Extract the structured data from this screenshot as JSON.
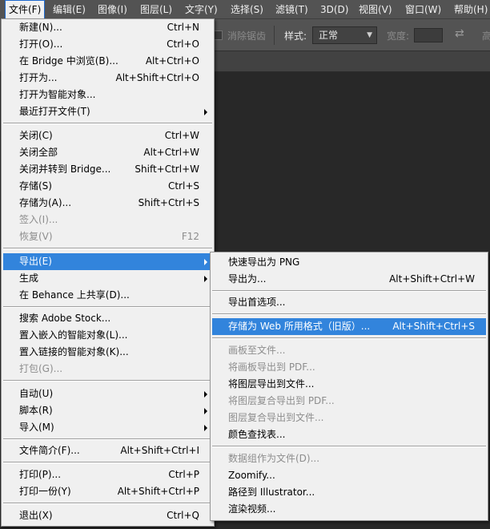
{
  "menubar": {
    "items": [
      {
        "label": "文件(F)"
      },
      {
        "label": "编辑(E)"
      },
      {
        "label": "图像(I)"
      },
      {
        "label": "图层(L)"
      },
      {
        "label": "文字(Y)"
      },
      {
        "label": "选择(S)"
      },
      {
        "label": "滤镜(T)"
      },
      {
        "label": "3D(D)"
      },
      {
        "label": "视图(V)"
      },
      {
        "label": "窗口(W)"
      },
      {
        "label": "帮助(H)"
      }
    ]
  },
  "options": {
    "antialias_label": "消除锯齿",
    "style_label": "样式:",
    "style_value": "正常",
    "width_label": "宽度:",
    "height_label_partial": "高"
  },
  "file_menu": {
    "items": [
      {
        "label": "新建(N)...",
        "shortcut": "Ctrl+N"
      },
      {
        "label": "打开(O)...",
        "shortcut": "Ctrl+O"
      },
      {
        "label": "在 Bridge 中浏览(B)...",
        "shortcut": "Alt+Ctrl+O"
      },
      {
        "label": "打开为...",
        "shortcut": "Alt+Shift+Ctrl+O"
      },
      {
        "label": "打开为智能对象..."
      },
      {
        "label": "最近打开文件(T)"
      },
      {
        "label": "关闭(C)",
        "shortcut": "Ctrl+W"
      },
      {
        "label": "关闭全部",
        "shortcut": "Alt+Ctrl+W"
      },
      {
        "label": "关闭并转到 Bridge...",
        "shortcut": "Shift+Ctrl+W"
      },
      {
        "label": "存储(S)",
        "shortcut": "Ctrl+S"
      },
      {
        "label": "存储为(A)...",
        "shortcut": "Shift+Ctrl+S"
      },
      {
        "label": "签入(I)..."
      },
      {
        "label": "恢复(V)",
        "shortcut": "F12"
      },
      {
        "label": "导出(E)"
      },
      {
        "label": "生成"
      },
      {
        "label": "在 Behance 上共享(D)..."
      },
      {
        "label": "搜索 Adobe Stock..."
      },
      {
        "label": "置入嵌入的智能对象(L)..."
      },
      {
        "label": "置入链接的智能对象(K)..."
      },
      {
        "label": "打包(G)..."
      },
      {
        "label": "自动(U)"
      },
      {
        "label": "脚本(R)"
      },
      {
        "label": "导入(M)"
      },
      {
        "label": "文件简介(F)...",
        "shortcut": "Alt+Shift+Ctrl+I"
      },
      {
        "label": "打印(P)...",
        "shortcut": "Ctrl+P"
      },
      {
        "label": "打印一份(Y)",
        "shortcut": "Alt+Shift+Ctrl+P"
      },
      {
        "label": "退出(X)",
        "shortcut": "Ctrl+Q"
      }
    ]
  },
  "export_menu": {
    "items": [
      {
        "label": "快速导出为 PNG"
      },
      {
        "label": "导出为...",
        "shortcut": "Alt+Shift+Ctrl+W"
      },
      {
        "label": "导出首选项..."
      },
      {
        "label": "存储为 Web 所用格式（旧版）...",
        "shortcut": "Alt+Shift+Ctrl+S"
      },
      {
        "label": "画板至文件..."
      },
      {
        "label": "将画板导出到 PDF..."
      },
      {
        "label": "将图层导出到文件..."
      },
      {
        "label": "将图层复合导出到 PDF..."
      },
      {
        "label": "图层复合导出到文件..."
      },
      {
        "label": "颜色查找表..."
      },
      {
        "label": "数据组作为文件(D)..."
      },
      {
        "label": "Zoomify..."
      },
      {
        "label": "路径到 Illustrator..."
      },
      {
        "label": "渲染视频..."
      }
    ]
  }
}
